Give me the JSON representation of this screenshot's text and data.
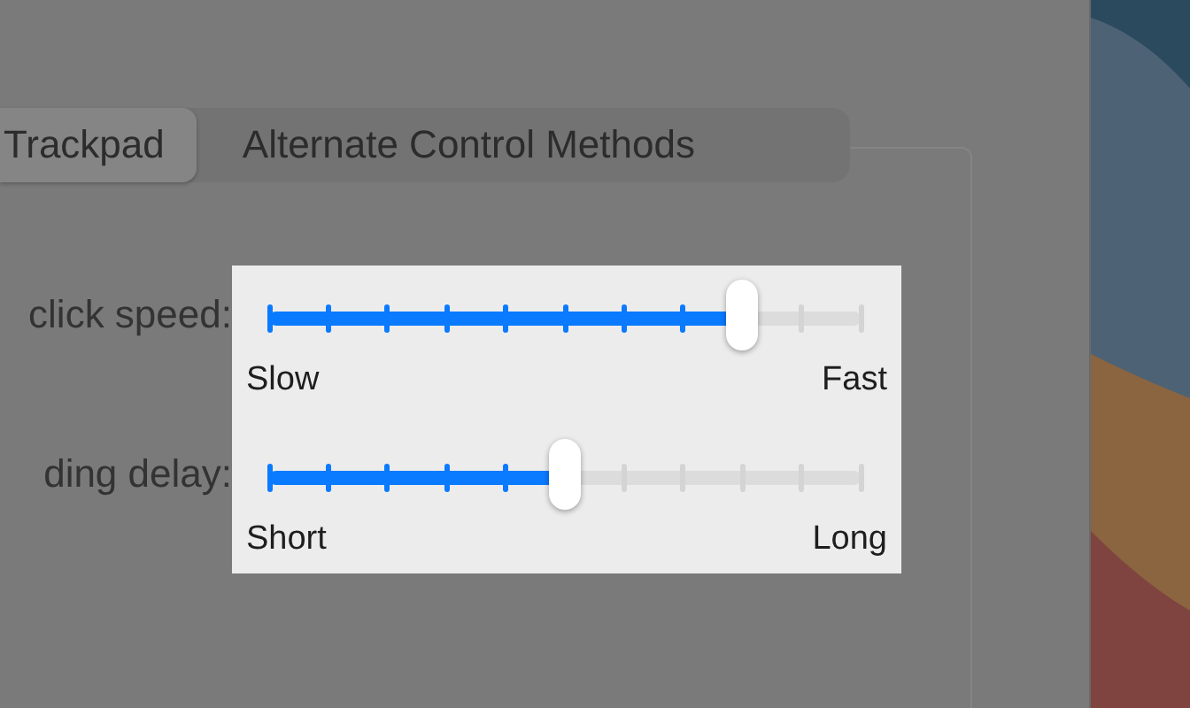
{
  "tabs": [
    {
      "label": "Trackpad",
      "selected": true
    },
    {
      "label": "Alternate Control Methods",
      "selected": false
    }
  ],
  "sliders": [
    {
      "label": "click speed:",
      "level": 0.8,
      "min_label": "Slow",
      "max_label": "Fast"
    },
    {
      "label": "ding delay:",
      "level": 0.5,
      "min_label": "Short",
      "max_label": "Long"
    }
  ]
}
